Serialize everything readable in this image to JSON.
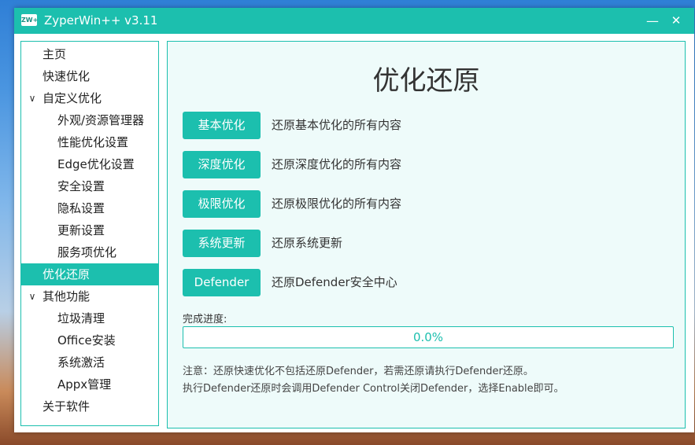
{
  "window": {
    "title": "ZyperWin++ v3.11",
    "icon_text": "ZW+",
    "minimize_glyph": "—",
    "close_glyph": "✕"
  },
  "sidebar": {
    "items": [
      {
        "label": "主页",
        "level": 0,
        "expandable": false
      },
      {
        "label": "快速优化",
        "level": 0,
        "expandable": false
      },
      {
        "label": "自定义优化",
        "level": 0,
        "expandable": true
      },
      {
        "label": "外观/资源管理器",
        "level": 1,
        "expandable": false
      },
      {
        "label": "性能优化设置",
        "level": 1,
        "expandable": false
      },
      {
        "label": "Edge优化设置",
        "level": 1,
        "expandable": false
      },
      {
        "label": "安全设置",
        "level": 1,
        "expandable": false
      },
      {
        "label": "隐私设置",
        "level": 1,
        "expandable": false
      },
      {
        "label": "更新设置",
        "level": 1,
        "expandable": false
      },
      {
        "label": "服务项优化",
        "level": 1,
        "expandable": false
      },
      {
        "label": "优化还原",
        "level": 0,
        "expandable": false,
        "active": true
      },
      {
        "label": "其他功能",
        "level": 0,
        "expandable": true
      },
      {
        "label": "垃圾清理",
        "level": 1,
        "expandable": false
      },
      {
        "label": "Office安装",
        "level": 1,
        "expandable": false
      },
      {
        "label": "系统激活",
        "level": 1,
        "expandable": false
      },
      {
        "label": "Appx管理",
        "level": 1,
        "expandable": false
      },
      {
        "label": "关于软件",
        "level": 0,
        "expandable": false
      }
    ],
    "chevron_glyph": "∨"
  },
  "main": {
    "title": "优化还原",
    "actions": [
      {
        "button": "基本优化",
        "description": "还原基本优化的所有内容"
      },
      {
        "button": "深度优化",
        "description": "还原深度优化的所有内容"
      },
      {
        "button": "极限优化",
        "description": "还原极限优化的所有内容"
      },
      {
        "button": "系统更新",
        "description": "还原系统更新"
      },
      {
        "button": "Defender",
        "description": "还原Defender安全中心"
      }
    ],
    "progress": {
      "label": "完成进度:",
      "value_text": "0.0%",
      "fraction": 0.0
    },
    "notes": [
      "注意：还原快速优化不包括还原Defender，若需还原请执行Defender还原。",
      "执行Defender还原时会调用Defender Control关闭Defender，选择Enable即可。"
    ]
  },
  "theme": {
    "accent": "#1cbfae",
    "panel_bg": "#eefbfa"
  }
}
